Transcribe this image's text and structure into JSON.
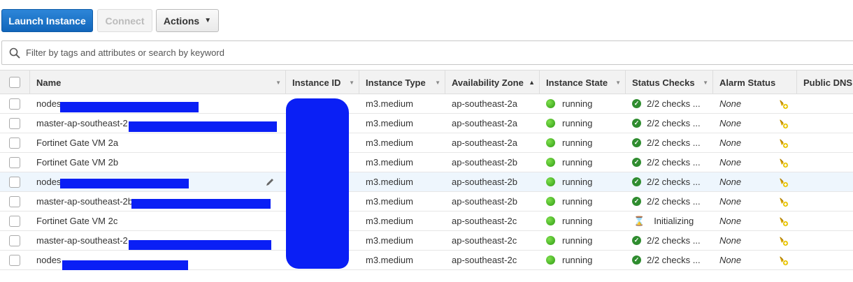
{
  "toolbar": {
    "launch_label": "Launch Instance",
    "connect_label": "Connect",
    "actions_label": "Actions"
  },
  "search": {
    "placeholder": "Filter by tags and attributes or search by keyword"
  },
  "table": {
    "columns": {
      "name": "Name",
      "instance_id": "Instance ID",
      "instance_type": "Instance Type",
      "availability_zone": "Availability Zone",
      "instance_state": "Instance State",
      "status_checks": "Status Checks",
      "alarm_status": "Alarm Status",
      "public_dns": "Public DNS"
    },
    "rows": [
      {
        "name": "nodes",
        "type": "m3.medium",
        "az": "ap-southeast-2a",
        "state": "running",
        "checks": "2/2 checks ...",
        "alarm": "None"
      },
      {
        "name": "master-ap-southeast-2",
        "type": "m3.medium",
        "az": "ap-southeast-2a",
        "state": "running",
        "checks": "2/2 checks ...",
        "alarm": "None"
      },
      {
        "name": "Fortinet Gate VM 2a",
        "type": "m3.medium",
        "az": "ap-southeast-2a",
        "state": "running",
        "checks": "2/2 checks ...",
        "alarm": "None"
      },
      {
        "name": "Fortinet Gate VM 2b",
        "type": "m3.medium",
        "az": "ap-southeast-2b",
        "state": "running",
        "checks": "2/2 checks ...",
        "alarm": "None"
      },
      {
        "name": "nodes",
        "type": "m3.medium",
        "az": "ap-southeast-2b",
        "state": "running",
        "checks": "2/2 checks ...",
        "alarm": "None"
      },
      {
        "name": "master-ap-southeast-2b",
        "type": "m3.medium",
        "az": "ap-southeast-2b",
        "state": "running",
        "checks": "2/2 checks ...",
        "alarm": "None"
      },
      {
        "name": "Fortinet Gate VM 2c",
        "type": "m3.medium",
        "az": "ap-southeast-2c",
        "state": "running",
        "checks": "Initializing",
        "alarm": "None"
      },
      {
        "name": "master-ap-southeast-2",
        "type": "m3.medium",
        "az": "ap-southeast-2c",
        "state": "running",
        "checks": "2/2 checks ...",
        "alarm": "None"
      },
      {
        "name": "nodes",
        "type": "m3.medium",
        "az": "ap-southeast-2c",
        "state": "running",
        "checks": "2/2 checks ...",
        "alarm": "None"
      }
    ]
  },
  "icons": {
    "search": "search-icon",
    "running": "green-circle-icon",
    "check_ok": "check-circle-icon",
    "initializing": "hourglass-icon",
    "alarm": "bell-plus-icon",
    "edit": "pencil-icon"
  },
  "colors": {
    "primary": "#1166bb",
    "running": "#2e9a14",
    "redaction": "#0a1ff5"
  }
}
